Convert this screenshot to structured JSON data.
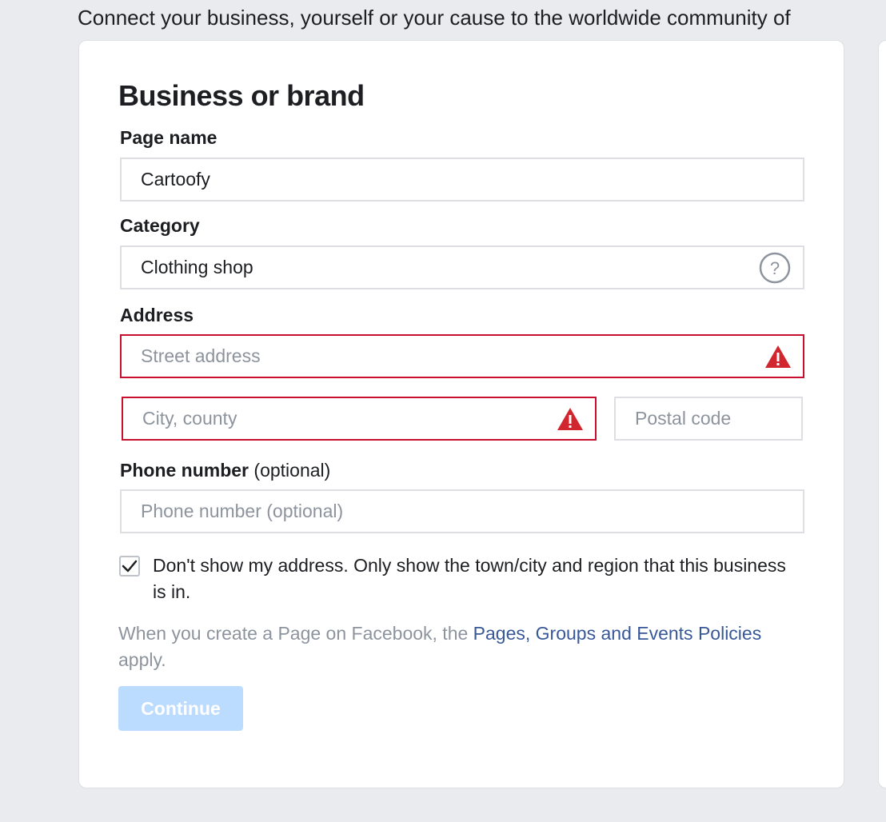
{
  "intro_text": "Connect your business, yourself or your cause to the worldwide community of",
  "card": {
    "title": "Business or brand",
    "page_name": {
      "label": "Page name",
      "value": "Cartoofy"
    },
    "category": {
      "label": "Category",
      "value": "Clothing shop",
      "help_icon": "question-circle-icon"
    },
    "address": {
      "label": "Address",
      "street_placeholder": "Street address",
      "city_placeholder": "City, county",
      "postal_placeholder": "Postal code",
      "error_icon": "warning-triangle-icon"
    },
    "phone": {
      "label": "Phone number",
      "label_suffix": "(optional)",
      "placeholder": "Phone number (optional)"
    },
    "hide_address": {
      "checked": true,
      "label": "Don't show my address. Only show the town/city and region that this business is in."
    },
    "policy": {
      "prefix": "When you create a Page on Facebook, the ",
      "link_text": "Pages, Groups and Events Policies",
      "suffix": " apply."
    },
    "continue_label": "Continue"
  },
  "colors": {
    "page_bg": "#e9ebee",
    "error": "#c8102e",
    "link": "#385898",
    "button_disabled": "#bcdcff"
  }
}
